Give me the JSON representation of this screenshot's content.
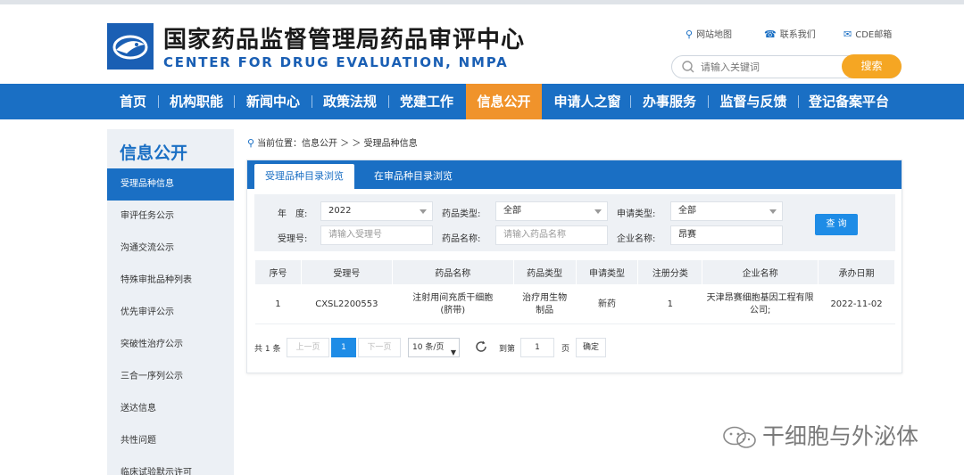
{
  "header": {
    "title": "国家药品监督管理局药品审评中心",
    "subtitle": "CENTER FOR DRUG EVALUATION, NMPA",
    "links": [
      {
        "icon": "location-pin-icon",
        "label": "网站地图"
      },
      {
        "icon": "phone-icon",
        "label": "联系我们"
      },
      {
        "icon": "mail-icon",
        "label": "CDE邮箱"
      }
    ],
    "search": {
      "placeholder": "请输入关键词",
      "button": "搜索"
    }
  },
  "nav": {
    "items": [
      "首页",
      "机构职能",
      "新闻中心",
      "政策法规",
      "党建工作",
      "信息公开",
      "申请人之窗",
      "办事服务",
      "监督与反馈",
      "登记备案平台"
    ],
    "active": "信息公开"
  },
  "sidebar": {
    "title": "信息公开",
    "items": [
      "受理品种信息",
      "审评任务公示",
      "沟通交流公示",
      "特殊审批品种列表",
      "优先审评公示",
      "突破性治疗公示",
      "三合一序列公示",
      "送达信息",
      "共性问题",
      "临床试验默示许可"
    ],
    "active": "受理品种信息"
  },
  "breadcrumb": {
    "text": "当前位置：信息公开 ＞ ＞ 受理品种信息"
  },
  "tabs": [
    "受理品种目录浏览",
    "在审品种目录浏览"
  ],
  "filters": {
    "year_label": "年　度:",
    "year_value": "2022",
    "drug_type_label": "药品类型:",
    "drug_type_value": "全部",
    "apply_type_label": "申请类型:",
    "apply_type_value": "全部",
    "accept_no_label": "受理号:",
    "accept_no_placeholder": "请输入受理号",
    "drug_name_label": "药品名称:",
    "drug_name_placeholder": "请输入药品名称",
    "company_label": "企业名称:",
    "company_value": "昂赛",
    "query_button": "查 询"
  },
  "table": {
    "headers": [
      "序号",
      "受理号",
      "药品名称",
      "药品类型",
      "申请类型",
      "注册分类",
      "企业名称",
      "承办日期"
    ],
    "rows": [
      [
        "1",
        "CXSL2200553",
        "注射用间充质干细胞(脐带)",
        "治疗用生物制品",
        "新药",
        "1",
        "天津昂赛细胞基因工程有限公司;",
        "2022-11-02"
      ]
    ]
  },
  "pagination": {
    "total": "共 1 条",
    "prev": "上一页",
    "current": "1",
    "next": "下一页",
    "page_size": "10 条/页",
    "goto_label": "到第",
    "goto_value": "1",
    "page_unit": "页",
    "confirm": "确定"
  },
  "watermark": "干细胞与外泌体",
  "colors": {
    "brand_blue": "#1a6fc4",
    "accent_orange": "#f0932b",
    "search_orange": "#f5a623"
  }
}
